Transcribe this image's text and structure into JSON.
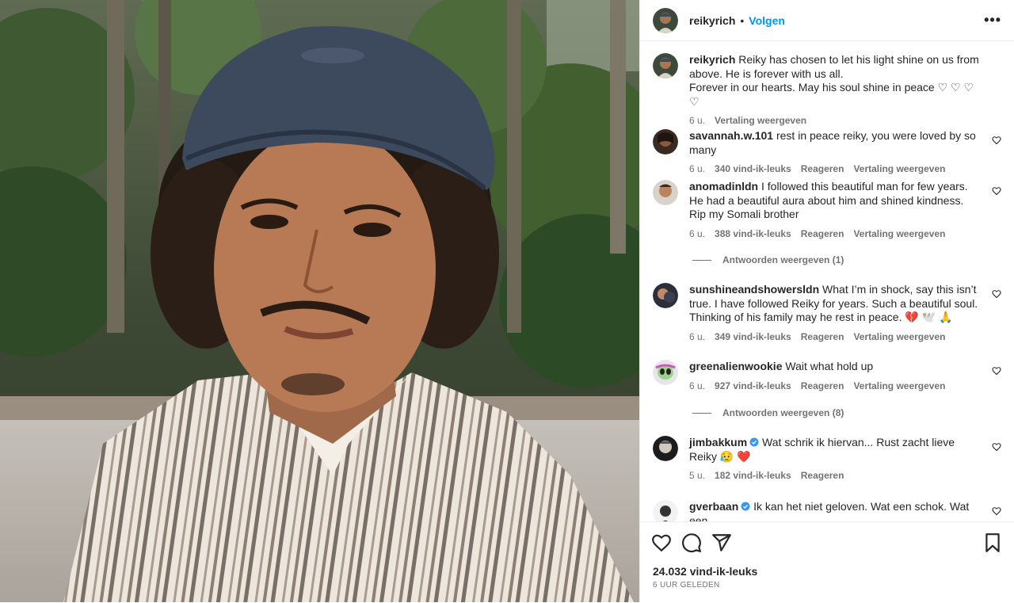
{
  "post": {
    "author": "reikyrich",
    "separator": "•",
    "follow_label": "Volgen",
    "more_label": "•••",
    "likes": "24.032 vind-ik-leuks",
    "time_ago": "6 UUR GELEDEN"
  },
  "caption": {
    "user": "reikyrich",
    "line1": "Reiky has chosen to let his light shine on us from above. He is forever with us all.",
    "line2": "Forever in our hearts. May his soul shine in peace ♡ ♡ ♡ ♡",
    "time": "6 u.",
    "translate": "Vertaling weergeven"
  },
  "comments": [
    {
      "user": "savannah.w.101",
      "text": "rest in peace reiky, you were loved by so many",
      "time": "6 u.",
      "likes": "340 vind-ik-leuks",
      "reply": "Reageren",
      "translate": "Vertaling weergeven",
      "verified": false
    },
    {
      "user": "anomadinldn",
      "text": "I followed this beautiful man for few years. He had a beautiful aura about him and shined kindness. Rip my Somali brother",
      "time": "6 u.",
      "likes": "388 vind-ik-leuks",
      "reply": "Reageren",
      "translate": "Vertaling weergeven",
      "verified": false
    },
    {
      "user": "sunshineandshowersldn",
      "text": "What I’m in shock, say this isn’t true. I have followed Reiky for years. Such a beautiful soul. Thinking of his family may he rest in peace. 💔 🕊️ 🙏",
      "time": "6 u.",
      "likes": "349 vind-ik-leuks",
      "reply": "Reageren",
      "translate": "Vertaling weergeven",
      "verified": false
    },
    {
      "user": "greenalienwookie",
      "text": "Wait what hold up",
      "time": "6 u.",
      "likes": "927 vind-ik-leuks",
      "reply": "Reageren",
      "translate": "Vertaling weergeven",
      "verified": false
    },
    {
      "user": "jimbakkum",
      "text": "Wat schrik ik hiervan... Rust zacht lieve Reiky 😥 ❤️",
      "time": "5 u.",
      "likes": "182 vind-ik-leuks",
      "reply": "Reageren",
      "translate": "",
      "verified": true
    },
    {
      "user": "gverbaan",
      "text": "Ik kan het niet geloven. Wat een schok. Wat een",
      "time": "",
      "likes": "",
      "reply": "",
      "translate": "",
      "verified": true
    }
  ],
  "reply_threads": [
    {
      "label": "Antwoorden weergeven (1)"
    },
    {
      "label": "Antwoorden weergeven (8)"
    }
  ]
}
